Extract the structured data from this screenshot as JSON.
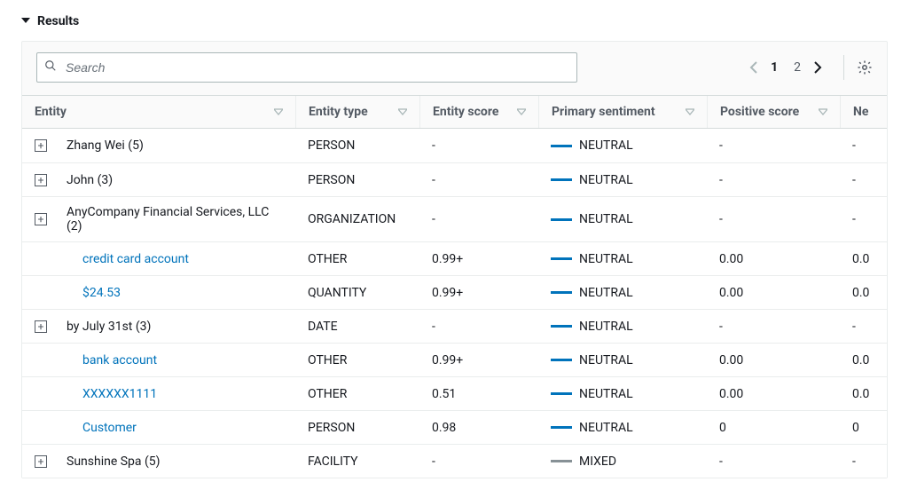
{
  "section_title": "Results",
  "search_placeholder": "Search",
  "pagination": {
    "current": "1",
    "other": "2"
  },
  "columns": {
    "entity": "Entity",
    "type": "Entity type",
    "score": "Entity score",
    "sentiment": "Primary sentiment",
    "positive": "Positive score",
    "negative_abbrev": "Ne"
  },
  "rows": [
    {
      "expandable": true,
      "link": false,
      "entity": "Zhang Wei (5)",
      "type": "PERSON",
      "score": "-",
      "sentiment": "NEUTRAL",
      "sentClass": "neutral",
      "positive": "-",
      "negative": "-"
    },
    {
      "expandable": true,
      "link": false,
      "entity": "John (3)",
      "type": "PERSON",
      "score": "-",
      "sentiment": "NEUTRAL",
      "sentClass": "neutral",
      "positive": "-",
      "negative": "-"
    },
    {
      "expandable": true,
      "link": false,
      "entity": "AnyCompany Financial Services, LLC (2)",
      "type": "ORGANIZATION",
      "score": "-",
      "sentiment": "NEUTRAL",
      "sentClass": "neutral",
      "positive": "-",
      "negative": "-"
    },
    {
      "expandable": false,
      "link": true,
      "entity": "credit card account",
      "type": "OTHER",
      "score": "0.99+",
      "sentiment": "NEUTRAL",
      "sentClass": "neutral",
      "positive": "0.00",
      "negative": "0.0"
    },
    {
      "expandable": false,
      "link": true,
      "entity": "$24.53",
      "type": "QUANTITY",
      "score": "0.99+",
      "sentiment": "NEUTRAL",
      "sentClass": "neutral",
      "positive": "0.00",
      "negative": "0.0"
    },
    {
      "expandable": true,
      "link": false,
      "entity": "by July 31st (3)",
      "type": "DATE",
      "score": "-",
      "sentiment": "NEUTRAL",
      "sentClass": "neutral",
      "positive": "-",
      "negative": "-"
    },
    {
      "expandable": false,
      "link": true,
      "entity": "bank account",
      "type": "OTHER",
      "score": "0.99+",
      "sentiment": "NEUTRAL",
      "sentClass": "neutral",
      "positive": "0.00",
      "negative": "0.0"
    },
    {
      "expandable": false,
      "link": true,
      "entity": "XXXXXX1111",
      "type": "OTHER",
      "score": "0.51",
      "sentiment": "NEUTRAL",
      "sentClass": "neutral",
      "positive": "0.00",
      "negative": "0.0"
    },
    {
      "expandable": false,
      "link": true,
      "entity": "Customer",
      "type": "PERSON",
      "score": "0.98",
      "sentiment": "NEUTRAL",
      "sentClass": "neutral",
      "positive": "0",
      "negative": "0"
    },
    {
      "expandable": true,
      "link": false,
      "entity": "Sunshine Spa (5)",
      "type": "FACILITY",
      "score": "-",
      "sentiment": "MIXED",
      "sentClass": "mixed",
      "positive": "-",
      "negative": "-"
    }
  ]
}
